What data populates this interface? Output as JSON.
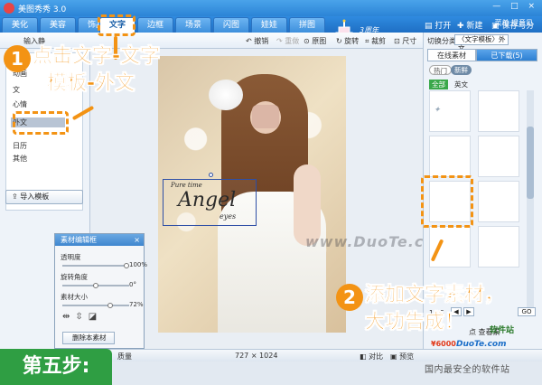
{
  "title_bar": {
    "app_title": "美图秀秀 3.0",
    "window_controls": "— □ ×"
  },
  "nav": {
    "tabs": [
      "美化",
      "美容",
      "饰品",
      "文字",
      "边框",
      "场景",
      "闪图",
      "娃娃",
      "拼图"
    ],
    "active_tab": "文字",
    "anniversary": "3周年",
    "open_label": "打开",
    "new_label": "新建",
    "save_label": "保存与分享",
    "user_menu": "菜单  提意见"
  },
  "toolbar": {
    "input_text": "输入静",
    "undo": "撤销",
    "redo": "重做",
    "original": "原图",
    "rotate": "旋转",
    "crop": "裁剪",
    "size": "尺寸"
  },
  "left_panel": {
    "items": [
      "动画",
      "文",
      "心情",
      "外文",
      "日历",
      "其他"
    ],
    "selected": "外文",
    "import_button": "导入模板"
  },
  "material_editor": {
    "title": "素材编辑框",
    "opacity_label": "透明度",
    "opacity_value": "100%",
    "rotation_label": "旋转角度",
    "rotation_value": "0°",
    "size_label": "素材大小",
    "size_value": "72%",
    "delete_button": "删除本素材"
  },
  "sticker": {
    "small": "Pure time",
    "big": "Angel",
    "eyes": "eyes"
  },
  "watermark": "www.DuoTe.com",
  "status_bar": {
    "quality": "质量",
    "dimensions": "727 × 1024",
    "compare": "对比",
    "preview": "预览"
  },
  "right_panel": {
    "switch_label": "切换分类",
    "category": "〈文字模板〉外文",
    "tab_online": "在线素材",
    "tab_downloaded": "已下载(5)",
    "chip_hot": "热门",
    "chip_new": "新鲜",
    "filter_all": "全部",
    "filter_en": "英文",
    "page_info": "1/15",
    "page_go": "GO",
    "price": "¥6000",
    "domain": "DuoTe.com",
    "promo": "点  查看素"
  },
  "site_watermark": "国内最安全的软件站",
  "site_watermark_top": "软件站",
  "annotations": {
    "step1_number": "1",
    "step1_line1": "点击文字-文字",
    "step1_line2": "模板-外文",
    "step2_number": "2",
    "step2_line1": "添加文字素材，",
    "step2_line2": "大功告成！",
    "step_banner": "第五步:"
  },
  "colors": {
    "accent": "#f39314",
    "brand_blue": "#2b84d6",
    "banner_green": "#2f9e43"
  }
}
